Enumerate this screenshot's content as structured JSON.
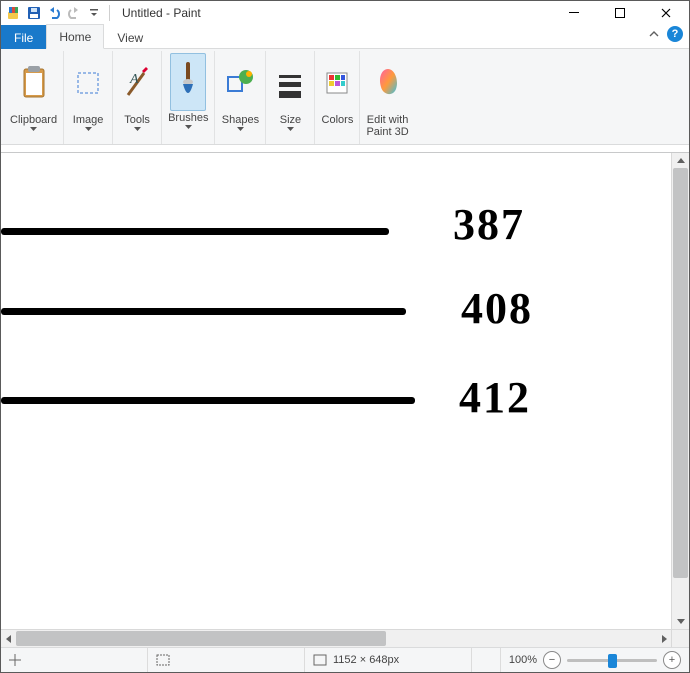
{
  "title": "Untitled - Paint",
  "tabs": {
    "file": "File",
    "home": "Home",
    "view": "View"
  },
  "ribbon": {
    "clipboard": "Clipboard",
    "image": "Image",
    "tools": "Tools",
    "brushes": "Brushes",
    "shapes": "Shapes",
    "size": "Size",
    "colors": "Colors",
    "edit3d_l1": "Edit with",
    "edit3d_l2": "Paint 3D"
  },
  "canvas": {
    "values": [
      "387",
      "408",
      "412"
    ]
  },
  "status": {
    "dimensions": "1152 × 648px",
    "zoom": "100%",
    "slider_pct": 50
  }
}
